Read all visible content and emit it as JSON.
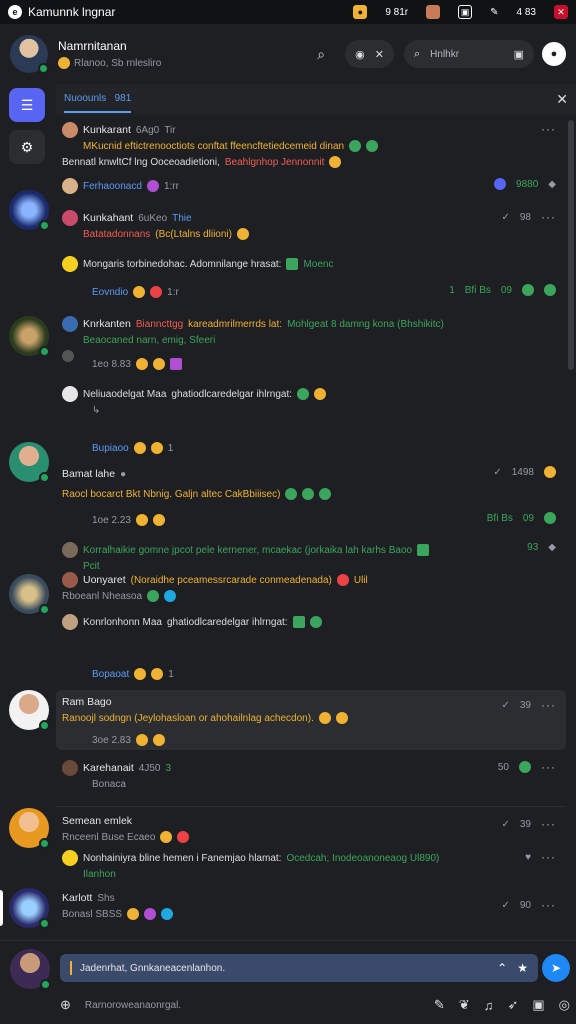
{
  "statusbar": {
    "title": "Kamunnk lngnar",
    "icon": "app-logo",
    "time_1": "9 81r",
    "time_2": "4 83"
  },
  "header": {
    "name": "Namrnitanan",
    "subtitle": "Rlanoo, Sb rnlesliro",
    "search_placeholder": "Hnlhkr"
  },
  "tabs": {
    "active": "Nuoounls",
    "count": "981"
  },
  "messages": [
    {
      "author": "Kunkarant",
      "handle": "6Ag0",
      "time": "Tir",
      "line1": "MKucnid eftictrenooctiots conftat ffeencftetiedcemeid dinan",
      "line2_a": "Bennatl knwltCf lng Ooceoadietioni,",
      "line2_b": "Beahlgnhop Jennonnit"
    },
    {
      "author": "Ferhaoonacd",
      "time": "1:rr",
      "right": "9880"
    },
    {
      "author": "Kunkahant",
      "handle": "6uKeo",
      "tag": "Thie",
      "line1_a": "Batatadonnans",
      "line1_b": "(Bc(Ltalns dliioni)",
      "right": "98"
    },
    {
      "line1": "Mongaris torbinedohac. Adomnilange hrasat:",
      "tail": "Moenc"
    },
    {
      "author": "Eovndio",
      "time": "1:r",
      "right_a": "1",
      "right_b": "Bfi Bs",
      "right_c": "09"
    },
    {
      "author": "Knrkanten",
      "line1_a": "Bianncttgg",
      "line1_b": "kareadmrilmerrds lat:",
      "line1_c": "Mohlgeat 8 damng kona (Bhshikitc)",
      "line2": "Beaocaned narn, emig, Sfeeri"
    },
    {
      "time": "1eo 8.83",
      "tail": ""
    },
    {
      "author": "Neliuaodelgat Maa",
      "line1": "ghatiodlcaredelgar ihlrngat:"
    },
    {
      "author": "Bupiaoo",
      "time": "1"
    },
    {
      "author": "Bamat lahe",
      "right": "1498",
      "line1": "Raocl bocarct Bkt Nbnig. Galjn altec CakBbiiisec)"
    },
    {
      "time": "1oe 2.23",
      "right_a": "Bfi Bs",
      "right_b": "09"
    },
    {
      "author": "Korralhaikie gomne jpcot pele kernener, mcaekac (jorkaika lah karhs Baoo",
      "line2": "Pcit",
      "right": "93"
    },
    {
      "author": "Uonyaret",
      "line1": "(Noraidhe pceamessrcarade conmeadenada)",
      "tail": "Ulil",
      "line2": "Rboeanl Nheasoa"
    },
    {
      "author": "Konrlonhonn Maa",
      "line1": "ghatiodlcaredelgar ihlrngat:"
    },
    {
      "author": "Bopaoat",
      "time": "1"
    },
    {
      "author": "Ram Bago",
      "line1": "Ranoojl sodngn (Jeylohasloan or ahohailnlag achecdon).",
      "time": "3oe 2.83",
      "right": "39"
    },
    {
      "author": "Karehanait",
      "handle": "4J50",
      "time": "3",
      "line2": "Bonaca",
      "right": "50"
    },
    {
      "author": "Semean emlek",
      "line1": "Rnceenl Buse Ecaeo",
      "right": "39"
    },
    {
      "line1": "Nonhainiyra bline hemen i Fanemjao hlamat:",
      "line1_b": "Ocedcah; Inodeoanoneaog Ul890)",
      "line2": "Ilanhon"
    },
    {
      "author": "Karlott",
      "handle": "Shs",
      "line2": "Bonasl SBSS",
      "right": "90"
    }
  ],
  "composer": {
    "draft": "Jadenrhat, Gnnkaneacenlanhon.",
    "hint": "Rarnoroweanaonrgal."
  }
}
